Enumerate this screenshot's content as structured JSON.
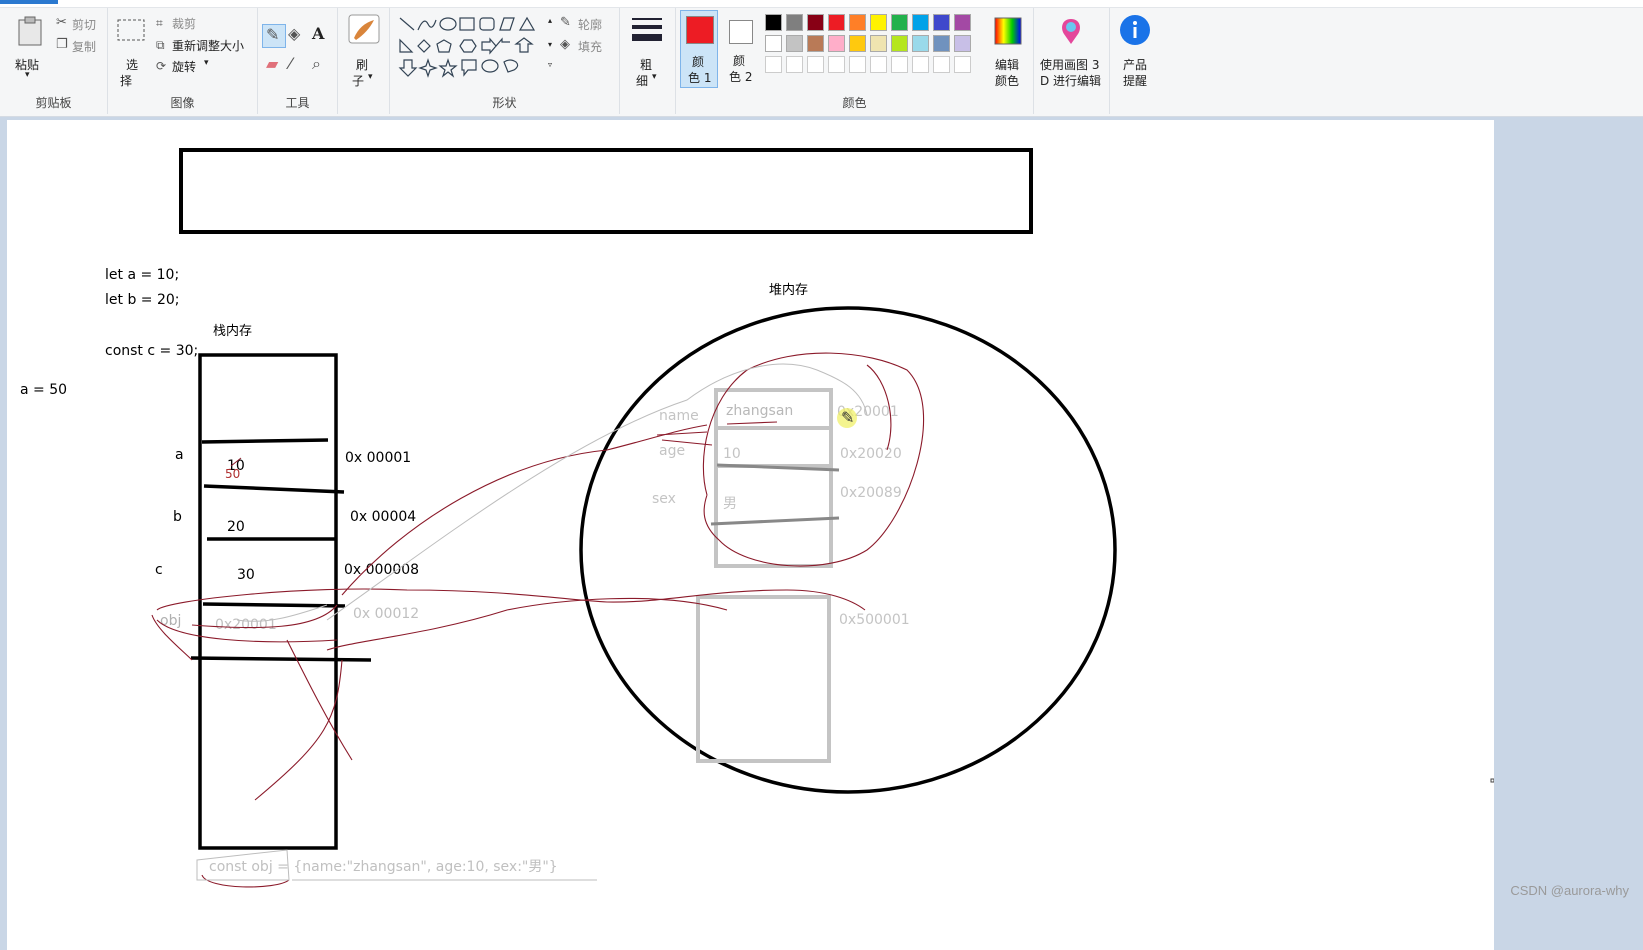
{
  "clipboard": {
    "paste": "粘贴",
    "cut": "剪切",
    "copy": "复制",
    "label": "剪贴板"
  },
  "image": {
    "select_l1": "选",
    "select_l2": "择",
    "crop": "裁剪",
    "resize": "重新调整大小",
    "rotate": "旋转",
    "label": "图像"
  },
  "tools": {
    "label": "工具",
    "text_icon": "A"
  },
  "brush": {
    "l1": "刷",
    "l2": "子"
  },
  "shapes": {
    "outline": "轮廓",
    "fill": "填充",
    "label": "形状"
  },
  "size": {
    "l1": "粗",
    "l2": "细"
  },
  "color1": {
    "l1": "颜",
    "l2": "色 1",
    "value": "#ed1c24"
  },
  "color2": {
    "l1": "颜",
    "l2": "色 2",
    "value": "#ffffff"
  },
  "palette": {
    "row1": [
      "#000000",
      "#7f7f7f",
      "#880015",
      "#ed1c24",
      "#ff7f27",
      "#fff200",
      "#22b14c",
      "#00a2e8",
      "#3f48cc",
      "#a349a4"
    ],
    "row2": [
      "#ffffff",
      "#c3c3c3",
      "#b97a57",
      "#ffaec9",
      "#ffc90e",
      "#efe4b0",
      "#b5e61d",
      "#99d9ea",
      "#7092be",
      "#c8bfe7"
    ],
    "label": "颜色"
  },
  "edit_colors": {
    "l1": "编辑",
    "l2": "颜色"
  },
  "paint3d": {
    "l1": "使用画图 3",
    "l2": "D 进行编辑"
  },
  "product": {
    "l1": "产品",
    "l2": "提醒"
  },
  "canvas": {
    "code_line1": "let a = 10;",
    "code_line2": "let b = 20;",
    "code_line3": "const c = 30;",
    "code_line4": "a = 50",
    "stack_title": "栈内存",
    "heap_title": "堆内存",
    "var_a": "a",
    "var_b": "b",
    "var_c": "c",
    "var_obj": "obj",
    "val_a": "10",
    "val_a_new": "50",
    "val_b": "20",
    "val_c": "30",
    "val_obj": "0x20001",
    "addr_a": "0x 00001",
    "addr_b": "0x 00004",
    "addr_c": "0x 000008",
    "addr_obj": "0x 00012",
    "heap_key_name": "name",
    "heap_key_age": "age",
    "heap_key_sex": "sex",
    "heap_val_name": "zhangsan",
    "heap_val_age": "10",
    "heap_val_sex": "男",
    "heap_addr1": "0x20001",
    "heap_addr2": "0x20020",
    "heap_addr3": "0x20089",
    "heap_addr4": "0x500001",
    "obj_decl": "const obj = {name:\"zhangsan\", age:10, sex:\"男\"}"
  },
  "watermark": "CSDN @aurora-why"
}
